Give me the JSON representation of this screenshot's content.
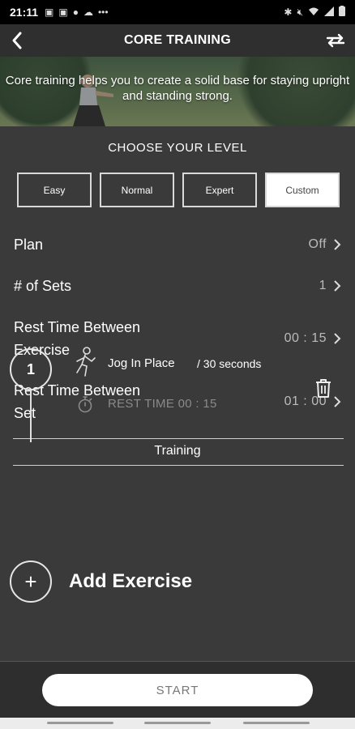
{
  "status_bar": {
    "time": "21:11",
    "left_icons": [
      "notification-icon",
      "notification-icon",
      "spotify-icon",
      "cloud-icon",
      "more-dots-icon"
    ],
    "right_icons": [
      "bluetooth-icon",
      "mute-icon",
      "wifi-icon",
      "signal-icon",
      "battery-icon"
    ]
  },
  "header": {
    "title": "CORE TRAINING",
    "back_icon": "back-arrow-icon",
    "swap_icon": "swap-arrows-icon"
  },
  "hero": {
    "description": "Core training helps you to create a solid base for staying upright and standing strong."
  },
  "level": {
    "title": "CHOOSE YOUR LEVEL",
    "options": [
      {
        "label": "Easy",
        "selected": false
      },
      {
        "label": "Normal",
        "selected": false
      },
      {
        "label": "Expert",
        "selected": false
      },
      {
        "label": "Custom",
        "selected": true
      }
    ]
  },
  "settings": {
    "plan": {
      "label": "Plan",
      "value": "Off"
    },
    "sets": {
      "label": "# of Sets",
      "value": "1"
    },
    "rest_exercise": {
      "label_line1": "Rest Time Between",
      "label_line2": "Exercise",
      "value": "00 : 15"
    },
    "rest_set": {
      "label_line1": "Rest Time Between",
      "label_line2": "Set",
      "value": "01 : 00"
    }
  },
  "training": {
    "section_label": "Training",
    "exercises": [
      {
        "number": "1",
        "name": "Jog In Place",
        "duration": "/ 30 seconds",
        "rest": "REST TIME 00 : 15"
      }
    ],
    "add_label": "Add Exercise",
    "add_symbol": "+"
  },
  "footer": {
    "start_label": "START"
  },
  "colors": {
    "background": "#3a3a3a",
    "header": "#2f2f2f",
    "muted_text": "#8a8a8a"
  }
}
